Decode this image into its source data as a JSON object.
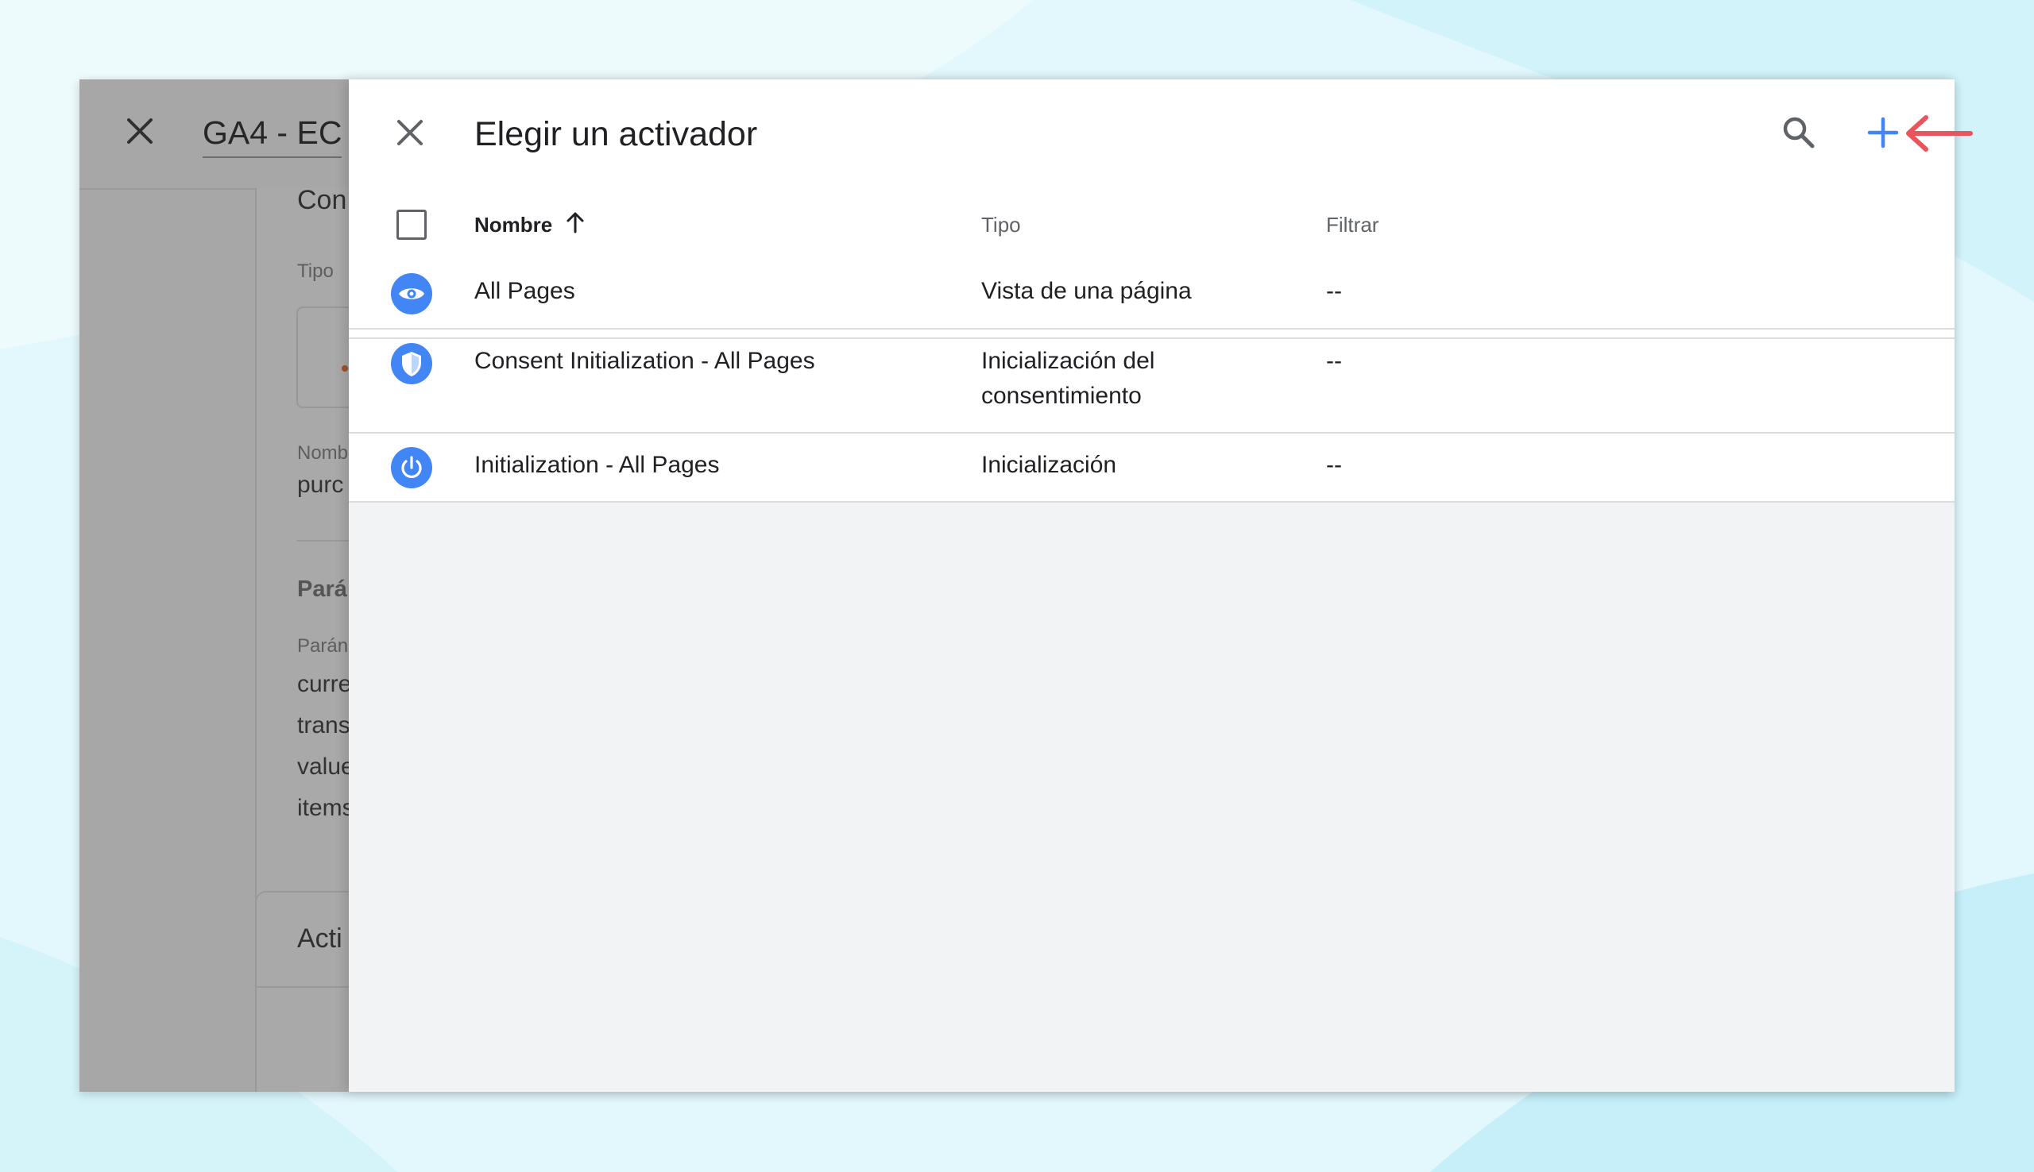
{
  "background_window": {
    "title": "GA4 - EC",
    "section_heading": "Con",
    "type_label": "Tipo",
    "name_label": "Nomb",
    "name_value": "purc",
    "params_heading": "Pará",
    "params_label": "Parán",
    "params": [
      "curre",
      "trans",
      "value",
      "items"
    ],
    "triggers_heading": "Acti"
  },
  "panel": {
    "title": "Elegir un activador",
    "search_icon": "search-icon",
    "add_icon": "plus-icon"
  },
  "table": {
    "columns": {
      "name": "Nombre",
      "type": "Tipo",
      "filter": "Filtrar"
    },
    "rows": [
      {
        "icon": "eye-icon",
        "name": "All Pages",
        "type": "Vista de una página",
        "filter": "--"
      },
      {
        "icon": "shield-icon",
        "name": "Consent Initialization - All Pages",
        "type": "Inicialización del consentimiento",
        "filter": "--"
      },
      {
        "icon": "power-icon",
        "name": "Initialization - All Pages",
        "type": "Inicialización",
        "filter": "--"
      }
    ]
  },
  "colors": {
    "accent_blue": "#4285f4",
    "annotation_red": "#e8555a",
    "overlay_gray": "#a7a7a7",
    "page_background": "#e2f8fd"
  }
}
